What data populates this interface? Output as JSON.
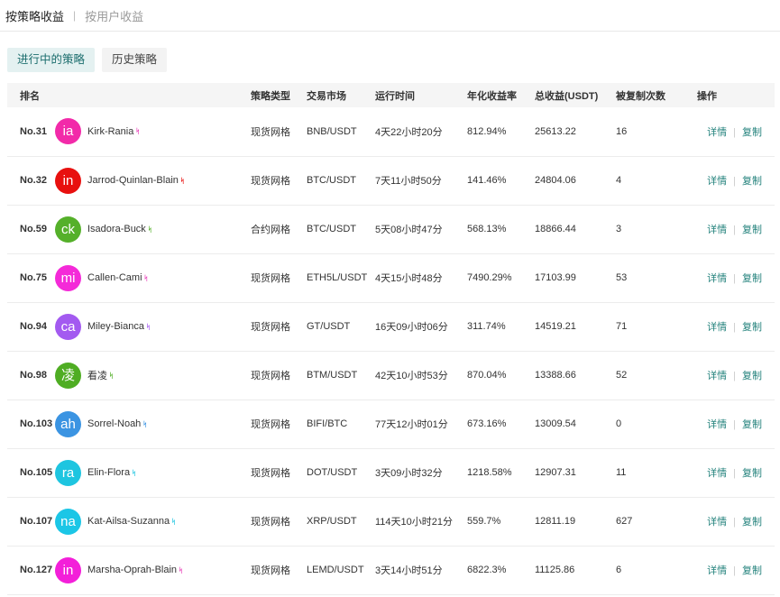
{
  "top_tabs": [
    {
      "label": "按策略收益"
    },
    {
      "label": "按用户收益"
    }
  ],
  "top_separator": "|",
  "sub_tabs": [
    {
      "label": "进行中的策略"
    },
    {
      "label": "历史策略"
    }
  ],
  "columns": [
    "排名",
    "策略类型",
    "交易市场",
    "运行时间",
    "年化收益率",
    "总收益(USDT)",
    "被复制次数",
    "操作"
  ],
  "actions": {
    "details": "详情",
    "copy": "复制",
    "separator": "|"
  },
  "badge_glyph": "ᛋ",
  "rows": [
    {
      "rank": "No.31",
      "avatar_text": "ia",
      "avatar_color": "#f22aa9",
      "badge_color": "#e83eb8",
      "name": "Kirk-Rania",
      "type": "现货网格",
      "market": "BNB/USDT",
      "runtime": "4天22小时20分",
      "annual": "812.94%",
      "total": "25613.22",
      "copies": "16"
    },
    {
      "rank": "No.32",
      "avatar_text": "in",
      "avatar_color": "#e8100f",
      "badge_color": "#e8100f",
      "name": "Jarrod-Quinlan-Blain",
      "type": "现货网格",
      "market": "BTC/USDT",
      "runtime": "7天11小时50分",
      "annual": "141.46%",
      "total": "24804.06",
      "copies": "4"
    },
    {
      "rank": "No.59",
      "avatar_text": "ck",
      "avatar_color": "#55b02a",
      "badge_color": "#55b02a",
      "name": "Isadora-Buck",
      "type": "合约网格",
      "market": "BTC/USDT",
      "runtime": "5天08小时47分",
      "annual": "568.13%",
      "total": "18866.44",
      "copies": "3"
    },
    {
      "rank": "No.75",
      "avatar_text": "mi",
      "avatar_color": "#f42ad8",
      "badge_color": "#e83eb8",
      "name": "Callen-Cami",
      "type": "现货网格",
      "market": "ETH5L/USDT",
      "runtime": "4天15小时48分",
      "annual": "7490.29%",
      "total": "17103.99",
      "copies": "53"
    },
    {
      "rank": "No.94",
      "avatar_text": "ca",
      "avatar_color": "#a35af0",
      "badge_color": "#a35af0",
      "name": "Miley-Bianca",
      "type": "现货网格",
      "market": "GT/USDT",
      "runtime": "16天09小时06分",
      "annual": "311.74%",
      "total": "14519.21",
      "copies": "71"
    },
    {
      "rank": "No.98",
      "avatar_text": "凌",
      "avatar_color": "#4fad23",
      "badge_color": "#4fad23",
      "name": "看凌",
      "type": "现货网格",
      "market": "BTM/USDT",
      "runtime": "42天10小时53分",
      "annual": "870.04%",
      "total": "13388.66",
      "copies": "52"
    },
    {
      "rank": "No.103",
      "avatar_text": "ah",
      "avatar_color": "#3b94e2",
      "badge_color": "#3b94e2",
      "name": "Sorrel-Noah",
      "type": "现货网格",
      "market": "BIFI/BTC",
      "runtime": "77天12小时01分",
      "annual": "673.16%",
      "total": "13009.54",
      "copies": "0"
    },
    {
      "rank": "No.105",
      "avatar_text": "ra",
      "avatar_color": "#1ec5e0",
      "badge_color": "#1ec5e0",
      "name": "Elin-Flora",
      "type": "现货网格",
      "market": "DOT/USDT",
      "runtime": "3天09小时32分",
      "annual": "1218.58%",
      "total": "12907.31",
      "copies": "11"
    },
    {
      "rank": "No.107",
      "avatar_text": "na",
      "avatar_color": "#1bc6e6",
      "badge_color": "#1ec5e0",
      "name": "Kat-Ailsa-Suzanna",
      "type": "现货网格",
      "market": "XRP/USDT",
      "runtime": "114天10小时21分",
      "annual": "559.7%",
      "total": "12811.19",
      "copies": "627"
    },
    {
      "rank": "No.127",
      "avatar_text": "in",
      "avatar_color": "#f31fd9",
      "badge_color": "#e83eb8",
      "name": "Marsha-Oprah-Blain",
      "type": "现货网格",
      "market": "LEMD/USDT",
      "runtime": "3天14小时51分",
      "annual": "6822.3%",
      "total": "11125.86",
      "copies": "6"
    }
  ]
}
